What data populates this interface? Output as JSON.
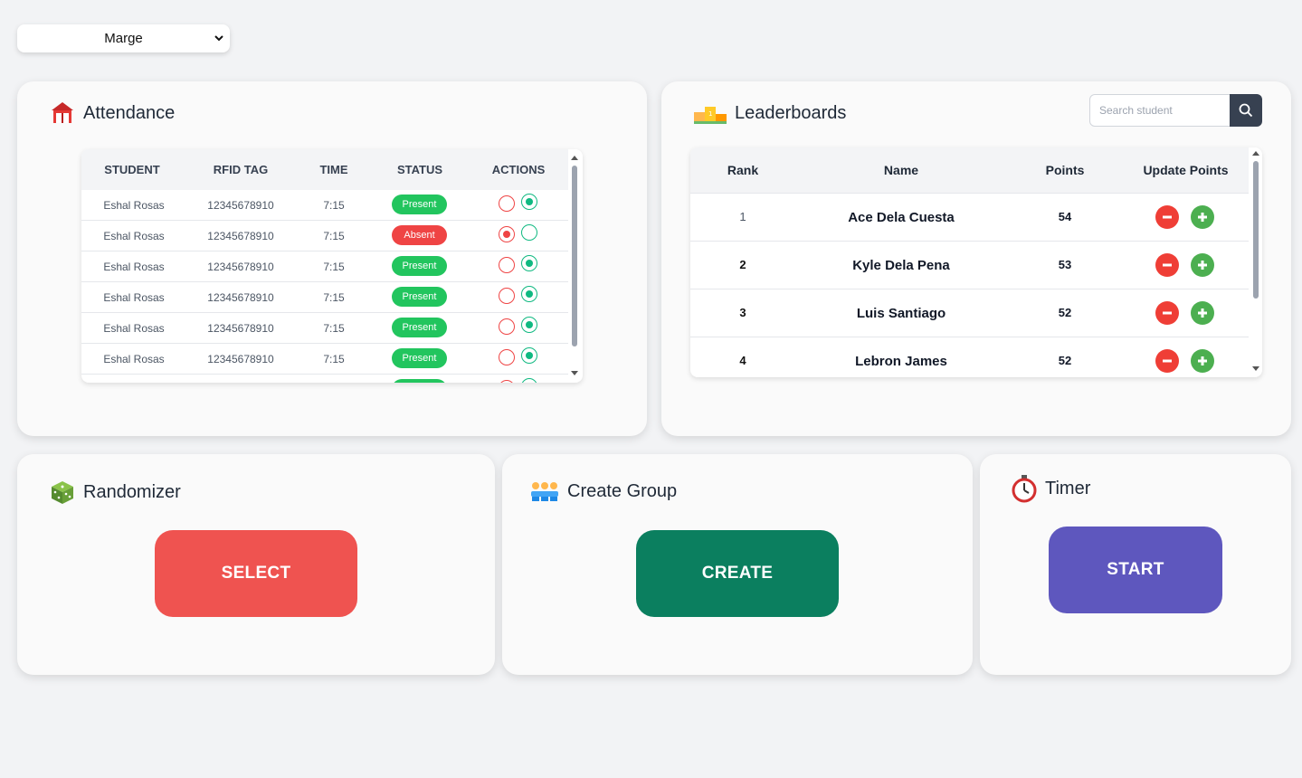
{
  "class_select": {
    "value": "Marge"
  },
  "attendance": {
    "title": "Attendance",
    "columns": [
      "STUDENT",
      "RFID TAG",
      "TIME",
      "STATUS",
      "ACTIONS"
    ],
    "rows": [
      {
        "student": "Eshal Rosas",
        "rfid": "12345678910",
        "time": "7:15",
        "status": "Present"
      },
      {
        "student": "Eshal Rosas",
        "rfid": "12345678910",
        "time": "7:15",
        "status": "Absent"
      },
      {
        "student": "Eshal Rosas",
        "rfid": "12345678910",
        "time": "7:15",
        "status": "Present"
      },
      {
        "student": "Eshal Rosas",
        "rfid": "12345678910",
        "time": "7:15",
        "status": "Present"
      },
      {
        "student": "Eshal Rosas",
        "rfid": "12345678910",
        "time": "7:15",
        "status": "Present"
      },
      {
        "student": "Eshal Rosas",
        "rfid": "12345678910",
        "time": "7:15",
        "status": "Present"
      }
    ]
  },
  "leaderboards": {
    "title": "Leaderboards",
    "search_placeholder": "Search student",
    "columns": [
      "Rank",
      "Name",
      "Points",
      "Update Points"
    ],
    "rows": [
      {
        "rank": "1",
        "name": "Ace Dela Cuesta",
        "points": "54"
      },
      {
        "rank": "2",
        "name": "Kyle Dela Pena",
        "points": "53"
      },
      {
        "rank": "3",
        "name": "Luis Santiago",
        "points": "52"
      },
      {
        "rank": "4",
        "name": "Lebron James",
        "points": "52"
      }
    ]
  },
  "randomizer": {
    "title": "Randomizer",
    "button": "SELECT"
  },
  "create_group": {
    "title": "Create Group",
    "button": "CREATE"
  },
  "timer": {
    "title": "Timer",
    "button": "START"
  },
  "colors": {
    "present": "#22c55e",
    "absent": "#ef4444",
    "select_btn": "#ef5350",
    "create_btn": "#0b7f5f",
    "start_btn": "#5e57be",
    "minus": "#ef3e36",
    "plus": "#4caf50"
  }
}
